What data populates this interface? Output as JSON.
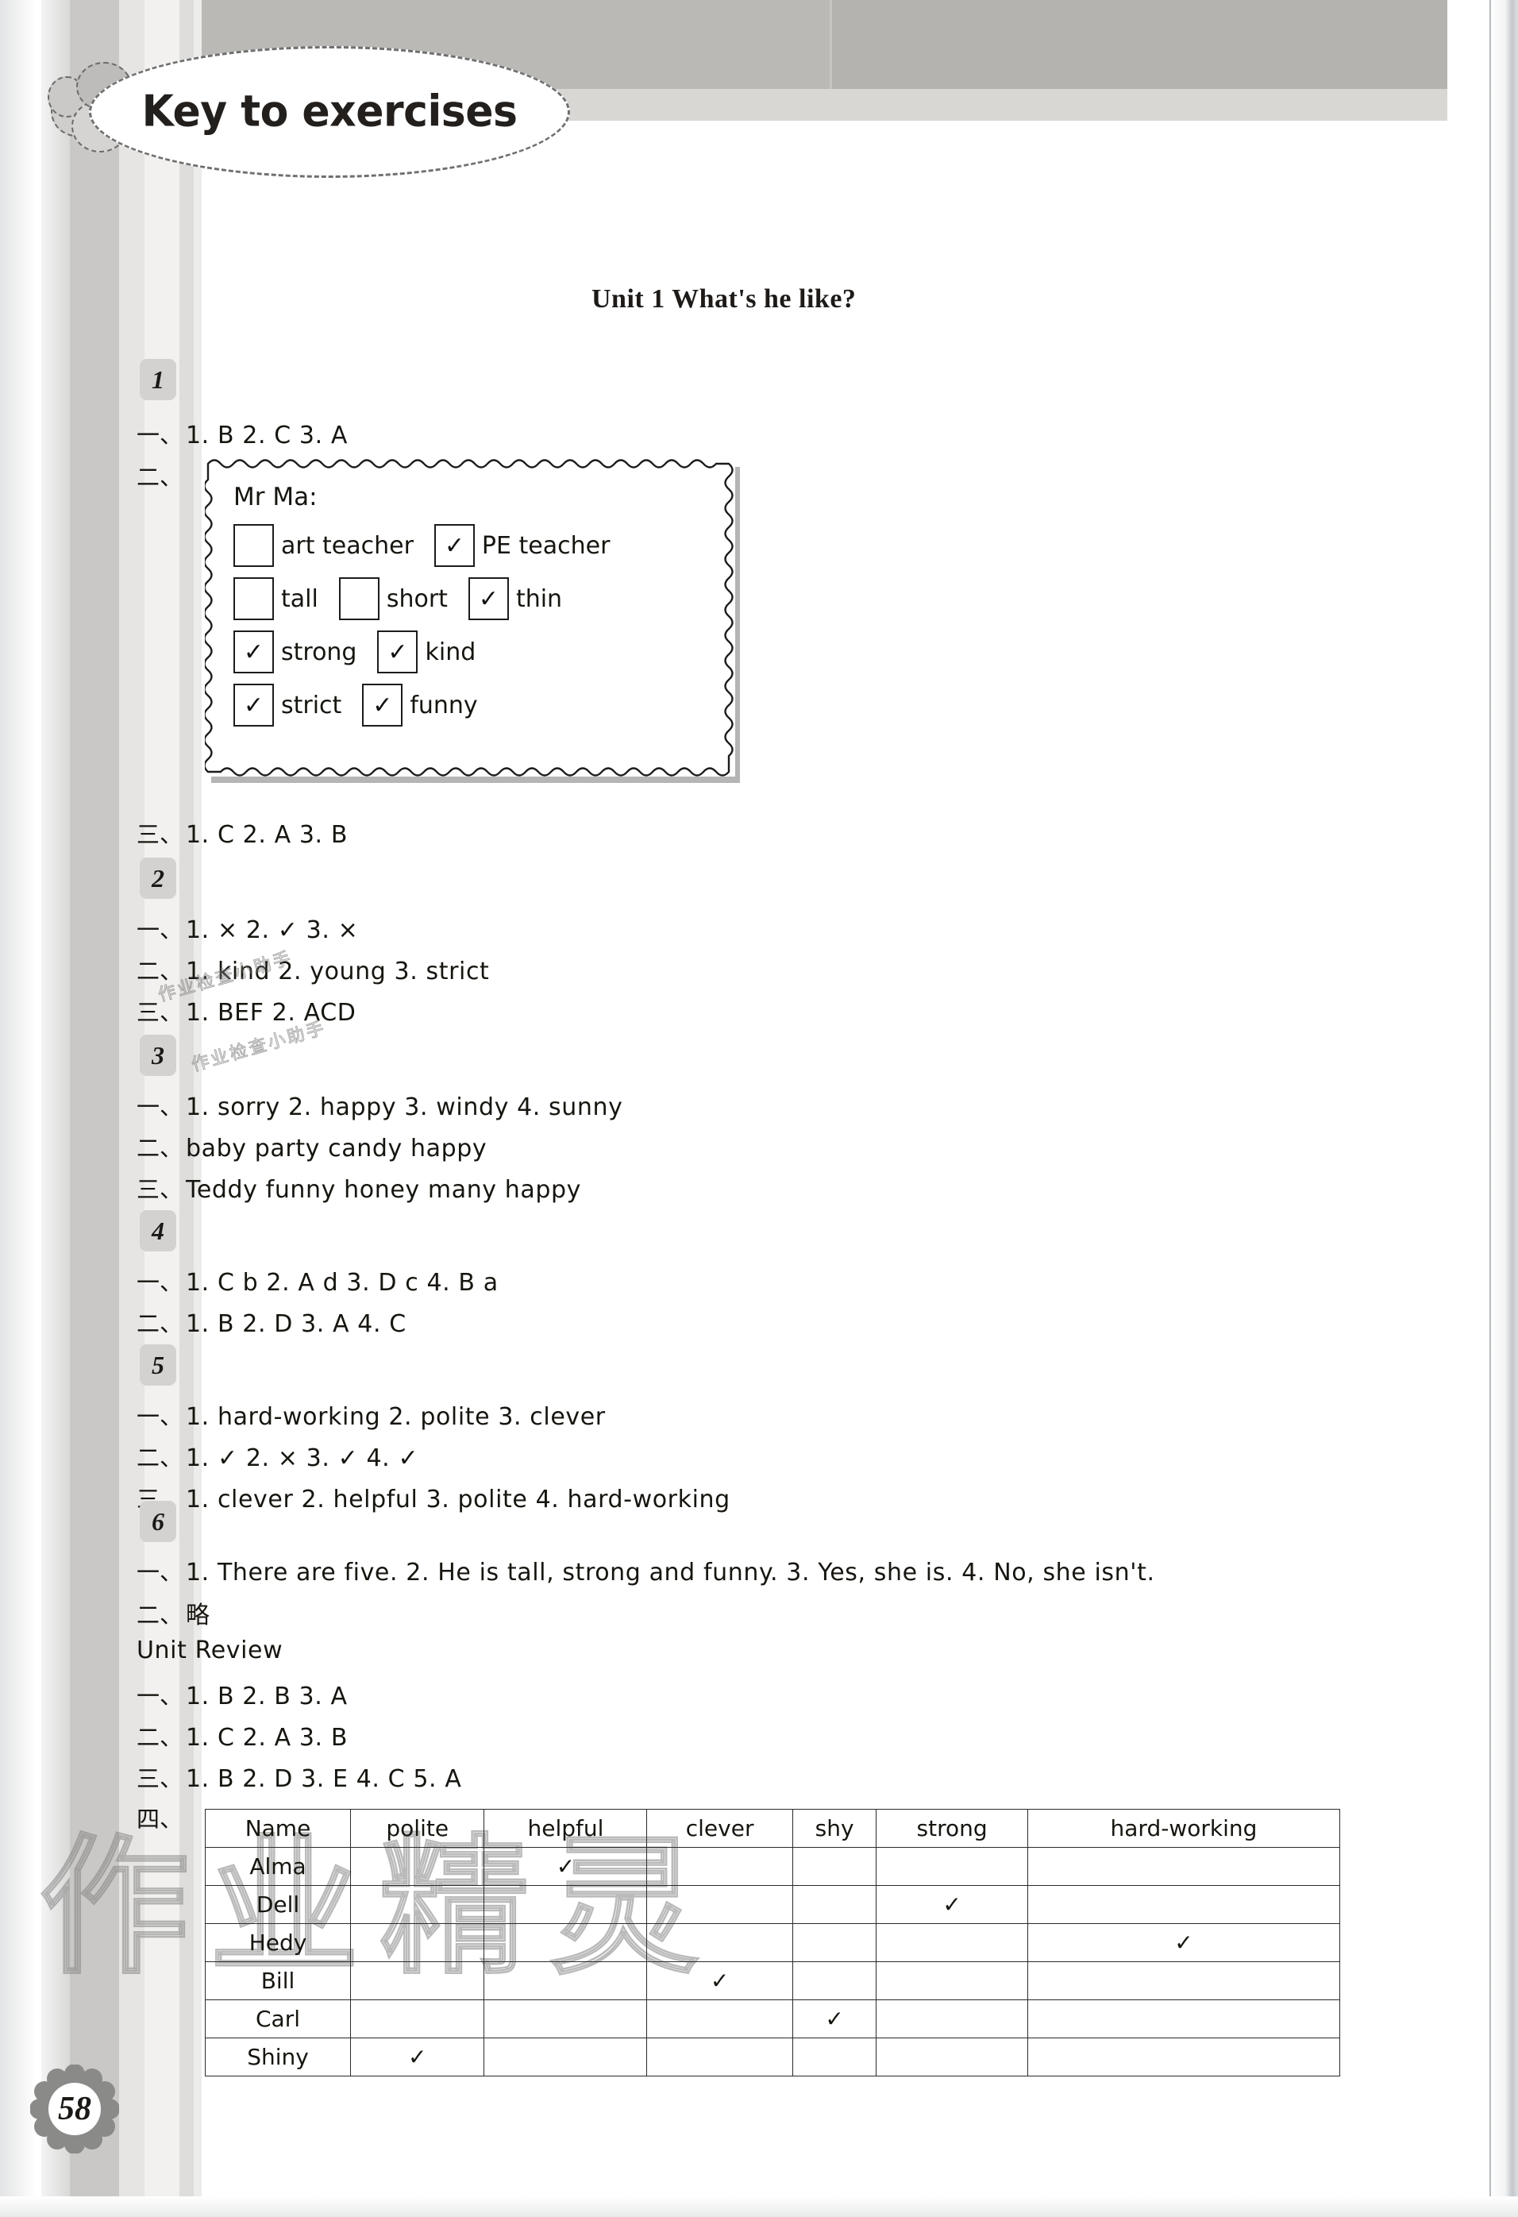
{
  "header": {
    "title": "Key to exercises"
  },
  "unit": {
    "title": "Unit 1    What's he like?"
  },
  "page_number": "58",
  "watermark": {
    "main": "作业精灵",
    "small_1": "作业检查小助手",
    "small_2": "作业检查小助手"
  },
  "markers": {
    "cn_1": "一、",
    "cn_2": "二、",
    "cn_3": "三、",
    "cn_4": "四、"
  },
  "exercises": [
    {
      "badge": "1",
      "lines": [
        {
          "marker": "一、",
          "answer": "1. B   2. C   3. A"
        }
      ],
      "box": {
        "name": "Mr Ma:",
        "rows": [
          [
            {
              "label": "art teacher",
              "checked": false
            },
            {
              "label": "PE teacher",
              "checked": true
            }
          ],
          [
            {
              "label": "tall",
              "checked": false
            },
            {
              "label": "short",
              "checked": false
            },
            {
              "label": "thin",
              "checked": true
            }
          ],
          [
            {
              "label": "strong",
              "checked": true
            },
            {
              "label": "kind",
              "checked": true
            }
          ],
          [
            {
              "label": "strict",
              "checked": true
            },
            {
              "label": "funny",
              "checked": true
            }
          ]
        ],
        "check_glyph": "✓"
      },
      "lines_after": [
        {
          "marker": "三、",
          "answer": "1. C   2. A   3. B"
        }
      ]
    },
    {
      "badge": "2",
      "lines": [
        {
          "marker": "一、",
          "answer": "1.   ×    2.   ✓   3.    ×"
        },
        {
          "marker": "二、",
          "answer": "1. kind   2. young   3. strict"
        },
        {
          "marker": "三、",
          "answer": "1. BEF   2. ACD"
        }
      ]
    },
    {
      "badge": "3",
      "lines": [
        {
          "marker": "一、",
          "answer": "1. sorry   2. happy   3. windy   4. sunny"
        },
        {
          "marker": "二、",
          "answer": "baby   party   candy   happy"
        },
        {
          "marker": "三、",
          "answer": "Teddy   funny   honey   many   happy"
        }
      ]
    },
    {
      "badge": "4",
      "lines": [
        {
          "marker": "一、",
          "answer": "1. C b   2. A d   3. D c   4. B a"
        },
        {
          "marker": "二、",
          "answer": "1. B   2. D   3. A   4. C"
        }
      ]
    },
    {
      "badge": "5",
      "lines": [
        {
          "marker": "一、",
          "answer": "1. hard-working   2. polite   3. clever"
        },
        {
          "marker": "二、",
          "answer": "1. ✓   2. ×   3. ✓   4. ✓"
        },
        {
          "marker": "三、",
          "answer": "1. clever   2. helpful   3. polite   4. hard-working"
        }
      ]
    },
    {
      "badge": "6",
      "lines": [
        {
          "marker": "一、",
          "answer": "1. There are five.   2. He is tall, strong and funny.   3. Yes, she is.    4. No, she isn't."
        },
        {
          "marker": "二、",
          "answer": "略"
        }
      ]
    }
  ],
  "unit_review": {
    "heading": "Unit  Review",
    "lines": [
      {
        "marker": "一、",
        "answer": "1. B   2. B   3. A"
      },
      {
        "marker": "二、",
        "answer": "1. C   2. A   3. B"
      },
      {
        "marker": "三、",
        "answer": "1. B   2. D   3. E   4. C   5. A"
      }
    ],
    "table_marker": "四、",
    "table": {
      "headers": [
        "Name",
        "polite",
        "helpful",
        "clever",
        "shy",
        "strong",
        "hard-working"
      ],
      "check_glyph": "✓",
      "rows": [
        {
          "name": "Alma",
          "checks": [
            "",
            "✓",
            "",
            "",
            "",
            ""
          ]
        },
        {
          "name": "Dell",
          "checks": [
            "",
            "",
            "",
            "",
            "✓",
            ""
          ]
        },
        {
          "name": "Hedy",
          "checks": [
            "",
            "",
            "",
            "",
            "",
            "✓"
          ]
        },
        {
          "name": "Bill",
          "checks": [
            "",
            "",
            "✓",
            "",
            "",
            ""
          ]
        },
        {
          "name": "Carl",
          "checks": [
            "",
            "",
            "",
            "✓",
            "",
            ""
          ]
        },
        {
          "name": "Shiny",
          "checks": [
            "✓",
            "",
            "",
            "",
            "",
            ""
          ]
        }
      ]
    }
  },
  "colors": {
    "badge_gray": "#d3d2d0",
    "banner_gray": "#bab9b6",
    "ink": "#17150f"
  }
}
